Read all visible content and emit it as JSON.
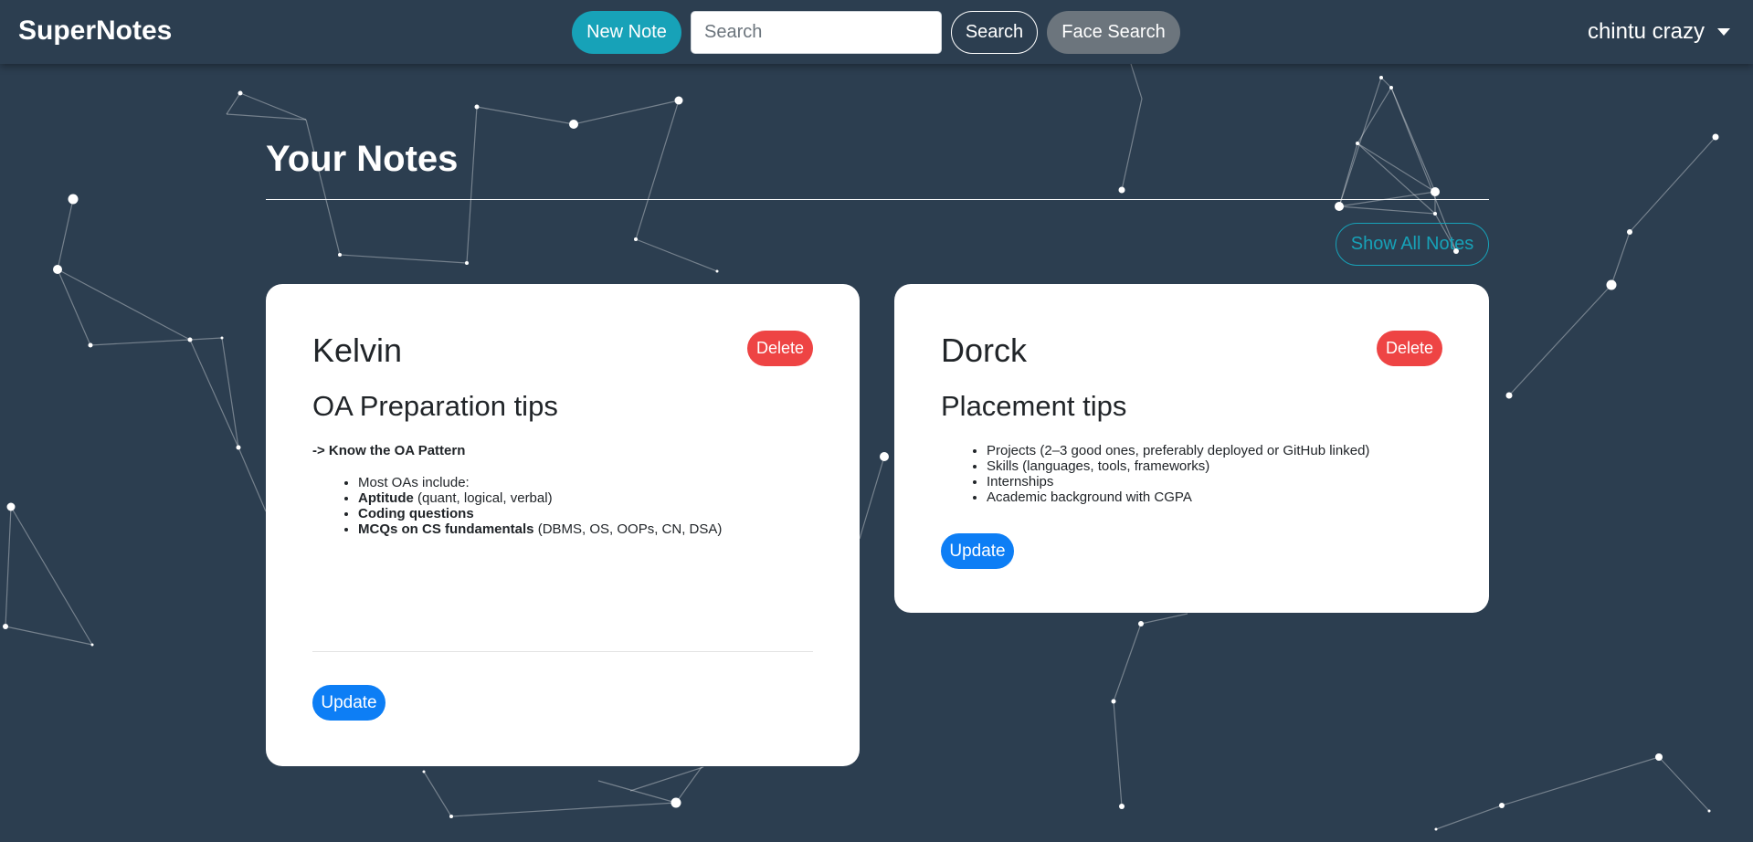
{
  "navbar": {
    "brand": "SuperNotes",
    "new_note_label": "New Note",
    "search_placeholder": "Search",
    "search_value": "",
    "search_button_label": "Search",
    "face_search_label": "Face Search",
    "user_name": "chintu crazy",
    "user_menu_icon": "caret-down-icon"
  },
  "main": {
    "page_title": "Your Notes",
    "show_all_label": "Show All Notes"
  },
  "notes": [
    {
      "author": "Kelvin",
      "delete_label": "Delete",
      "title": "OA Preparation tips",
      "heading": "-> Know the OA Pattern",
      "intro": "Most OAs include:",
      "items": [
        {
          "bold": "Aptitude",
          "rest": " (quant, logical, verbal)"
        },
        {
          "bold": "Coding questions",
          "rest": ""
        },
        {
          "bold": "MCQs on CS fundamentals",
          "rest": " (DBMS, OS, OOPs, CN, DSA)"
        }
      ],
      "update_label": "Update"
    },
    {
      "author": "Dorck",
      "delete_label": "Delete",
      "title": "Placement tips",
      "items": [
        "Projects (2–3 good ones, preferably deployed or GitHub linked)",
        "Skills (languages, tools, frameworks)",
        "Internships",
        "Academic background with CGPA"
      ],
      "update_label": "Update"
    }
  ],
  "colors": {
    "background": "#2c3e50",
    "primary": "#0d7ef5",
    "info": "#17a2b8",
    "danger": "#ee4444",
    "secondary": "#6c757d"
  }
}
